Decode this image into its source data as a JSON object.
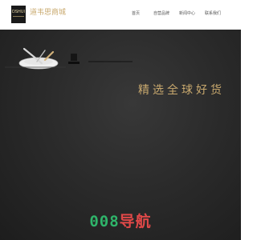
{
  "header": {
    "logo_mark": "DSHUI",
    "logo_name": "道韦思商城"
  },
  "nav": {
    "home": "首页",
    "brand": "自营品牌",
    "news": "新闻中心",
    "contact": "联系我们"
  },
  "hero": {
    "slogan": "精选全球好货"
  },
  "footer_brand": {
    "number": "008",
    "text": "导航"
  },
  "colors": {
    "gold": "#c9a96e",
    "dark": "#2b2b2b",
    "red": "#e04848",
    "green": "#2fb46a"
  }
}
